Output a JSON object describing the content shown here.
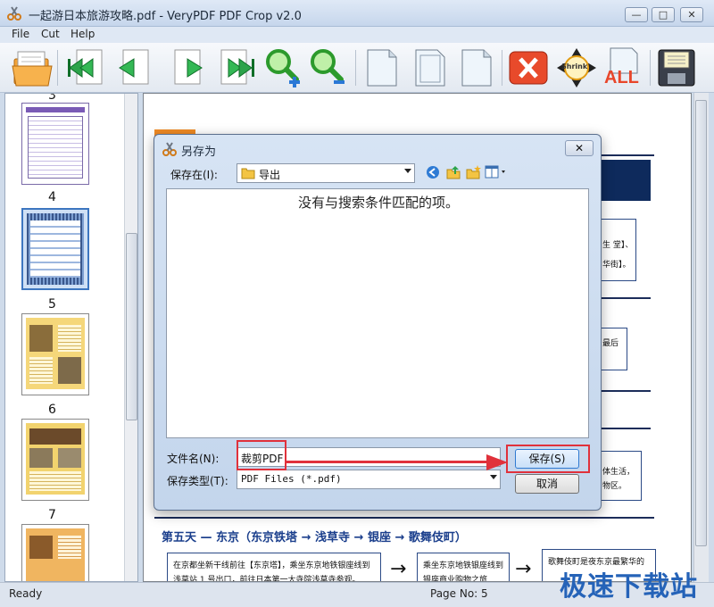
{
  "window": {
    "title": "一起游日本旅游攻略.pdf - VeryPDF PDF Crop v2.0",
    "controls": [
      "—",
      "□",
      "✕"
    ]
  },
  "menu": [
    "File",
    "Cut",
    "Help"
  ],
  "toolbar": {
    "buttons": [
      "open-folder",
      "first-page",
      "prev-page",
      "next-page",
      "last-page",
      "zoom-in",
      "zoom-out",
      "page-single",
      "page-portrait",
      "page-blank",
      "cancel-x",
      "shrink",
      "all",
      "save-floppy"
    ],
    "labels": {
      "shrink": "Shrink",
      "all": "ALL"
    }
  },
  "thumbnails": [
    {
      "num": "3",
      "style": "purple"
    },
    {
      "num": "4",
      "style": "blue-selected"
    },
    {
      "num": "5",
      "style": "yellow"
    },
    {
      "num": "6",
      "style": "yellow-photo"
    },
    {
      "num": "7",
      "style": "orange"
    }
  ],
  "document": {
    "snippet_right": [
      "生 堂】、",
      "华街】。",
      "最后",
      "体生活，",
      "物区。"
    ],
    "day5_heading": "第五天 — 东京（东京铁塔 → 浅草寺 → 银座 → 歌舞伎町）",
    "day5_boxes": [
      "在京都坐新干线前往【东京塔】，乘坐东京地铁银座线到浅草站 1 号出口，前往日本第一大寺院浅草寺参观。",
      "乘坐东京地铁银座线到银座商业购物之旅",
      "歌舞伎町是夜东京最繁华的"
    ]
  },
  "dialog": {
    "title": "另存为",
    "save_in_label": "保存在(I):",
    "save_in_value": "导出",
    "empty_message": "没有与搜索条件匹配的项。",
    "filename_label": "文件名(N):",
    "filename_value": "裁剪PDF",
    "filetype_label": "保存类型(T):",
    "filetype_value": "PDF Files (*.pdf)",
    "save_button": "保存(S)",
    "cancel_button": "取消",
    "close": "✕"
  },
  "status": {
    "left": "Ready",
    "page": "Page No: 5"
  },
  "watermark": "极速下载站",
  "colors": {
    "highlight": "#e0313b",
    "accent": "#2563b8"
  }
}
